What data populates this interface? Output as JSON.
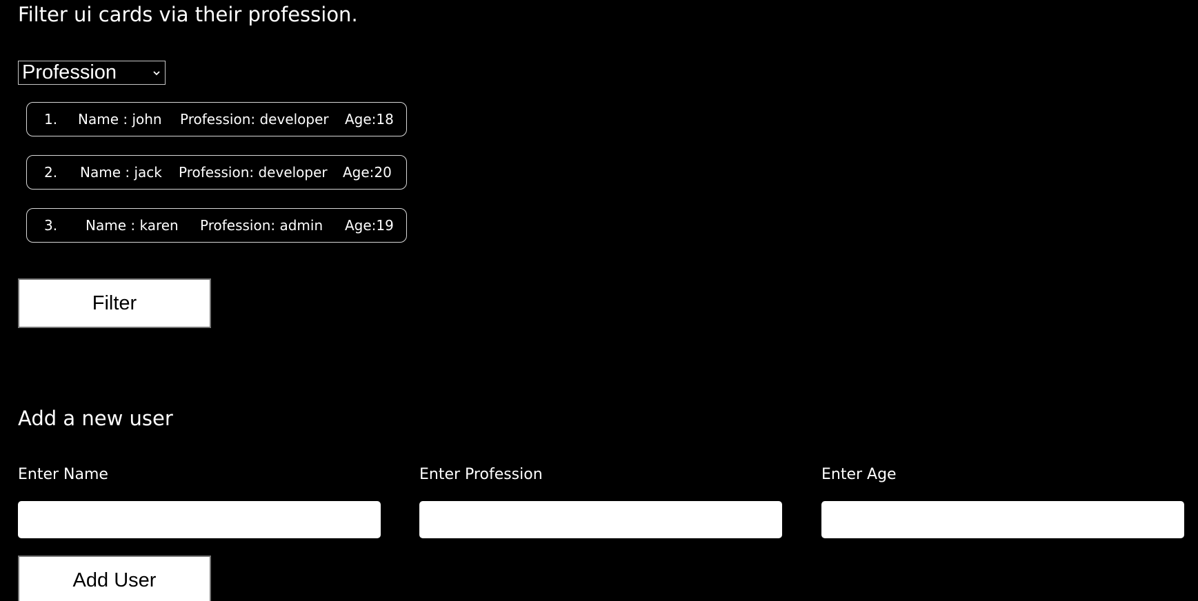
{
  "heading": "Filter ui cards via their profession.",
  "filter_select": {
    "selected": "Profession"
  },
  "users": [
    {
      "index": "1.",
      "name": "Name : john",
      "profession": "Profession: developer",
      "age": "Age:18"
    },
    {
      "index": "2.",
      "name": "Name : jack",
      "profession": "Profession: developer",
      "age": "Age:20"
    },
    {
      "index": "3.",
      "name": "Name : karen",
      "profession": "Profession: admin",
      "age": "Age:19"
    }
  ],
  "filter_button_label": "Filter",
  "add_section": {
    "title": "Add a new user",
    "name_label": "Enter Name",
    "name_value": "",
    "profession_label": "Enter Profession",
    "profession_value": "",
    "age_label": "Enter Age",
    "age_value": "",
    "add_button_label": "Add User"
  },
  "colors": {
    "background": "#000000",
    "text": "#ffffff",
    "card_border": "#d9d9d9",
    "button_bg": "#ffffff"
  },
  "icons": {
    "select_chevron": "chevron-down-icon"
  }
}
